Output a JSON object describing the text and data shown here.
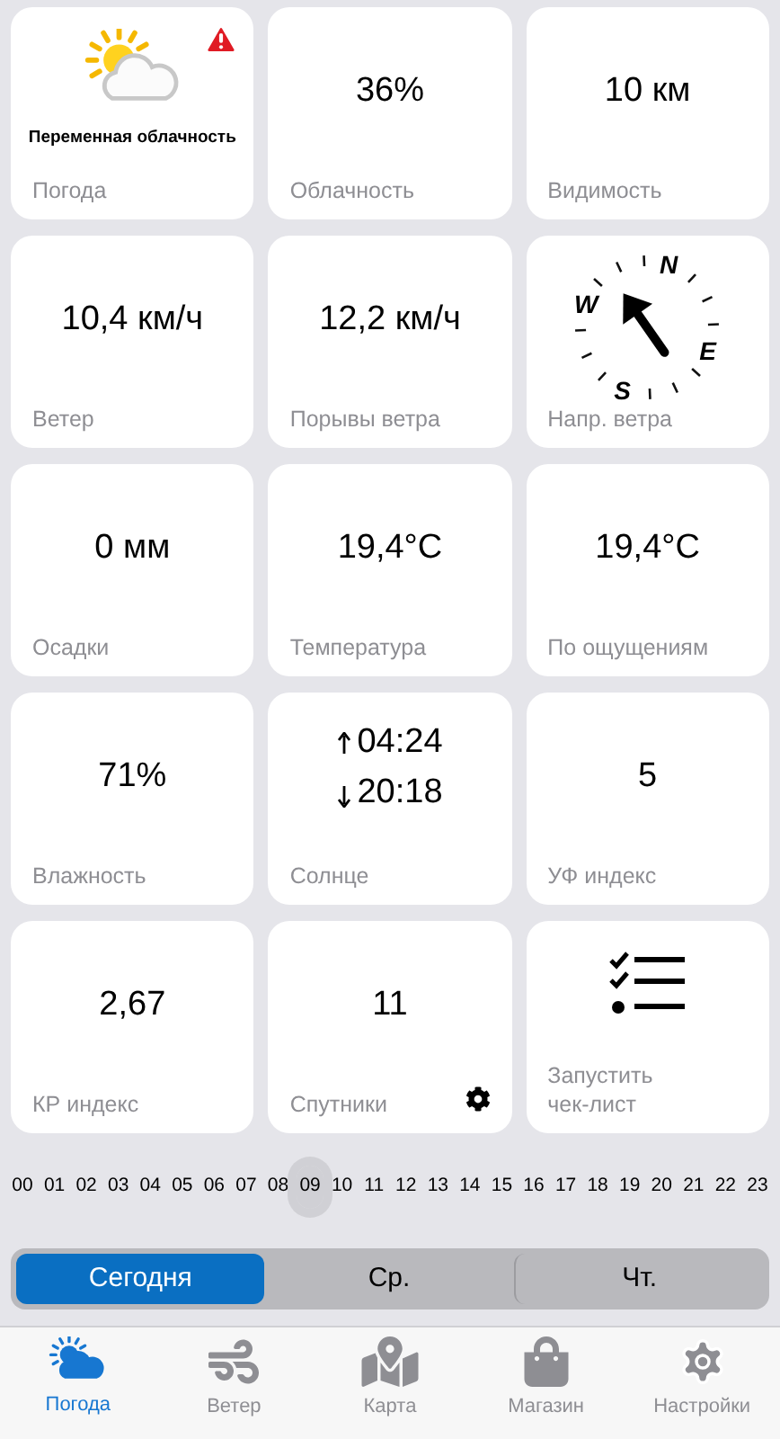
{
  "tiles": [
    {
      "kind": "weather",
      "caption": "Переменная облачность",
      "label": "Погода",
      "alert": true
    },
    {
      "kind": "value",
      "value": "36%",
      "label": "Облачность"
    },
    {
      "kind": "value",
      "value": "10 км",
      "label": "Видимость"
    },
    {
      "kind": "value",
      "value": "10,4 км/ч",
      "label": "Ветер"
    },
    {
      "kind": "value",
      "value": "12,2 км/ч",
      "label": "Порывы ветра"
    },
    {
      "kind": "compass",
      "points": [
        "N",
        "E",
        "S",
        "W"
      ],
      "label": "Напр. ветра"
    },
    {
      "kind": "value",
      "value": "0 мм",
      "label": "Осадки"
    },
    {
      "kind": "value",
      "value": "19,4°C",
      "label": "Температура"
    },
    {
      "kind": "value",
      "value": "19,4°C",
      "label": "По ощущениям"
    },
    {
      "kind": "value",
      "value": "71%",
      "label": "Влажность"
    },
    {
      "kind": "sun",
      "sunrise": "04:24",
      "sunset": "20:18",
      "label": "Солнце"
    },
    {
      "kind": "value",
      "value": "5",
      "label": "УФ индекс"
    },
    {
      "kind": "value",
      "value": "2,67",
      "label": "КР индекс"
    },
    {
      "kind": "value",
      "value": "11",
      "label": "Спутники",
      "settings": true
    },
    {
      "kind": "checklist",
      "label": "Запустить чек-лист"
    }
  ],
  "hours": [
    {
      "label": "00",
      "selected": false
    },
    {
      "label": "01",
      "selected": false
    },
    {
      "label": "02",
      "selected": false
    },
    {
      "label": "03",
      "selected": false
    },
    {
      "label": "04",
      "selected": false
    },
    {
      "label": "05",
      "selected": false
    },
    {
      "label": "06",
      "selected": false
    },
    {
      "label": "07",
      "selected": false
    },
    {
      "label": "08",
      "selected": false
    },
    {
      "label": "09",
      "selected": true
    },
    {
      "label": "10",
      "selected": false
    },
    {
      "label": "11",
      "selected": false
    },
    {
      "label": "12",
      "selected": false
    },
    {
      "label": "13",
      "selected": false
    },
    {
      "label": "14",
      "selected": false
    },
    {
      "label": "15",
      "selected": false
    },
    {
      "label": "16",
      "selected": false
    },
    {
      "label": "17",
      "selected": false
    },
    {
      "label": "18",
      "selected": false
    },
    {
      "label": "19",
      "selected": false
    },
    {
      "label": "20",
      "selected": false
    },
    {
      "label": "21",
      "selected": false
    },
    {
      "label": "22",
      "selected": false
    },
    {
      "label": "23",
      "selected": false
    }
  ],
  "days": [
    {
      "label": "Сегодня",
      "selected": true
    },
    {
      "label": "Ср.",
      "selected": false
    },
    {
      "label": "Чт.",
      "selected": false
    }
  ],
  "nav": [
    {
      "kind": "weather",
      "label": "Погода",
      "selected": true
    },
    {
      "kind": "wind",
      "label": "Ветер",
      "selected": false
    },
    {
      "kind": "map",
      "label": "Карта",
      "selected": false
    },
    {
      "kind": "shop",
      "label": "Магазин",
      "selected": false
    },
    {
      "kind": "settings",
      "label": "Настройки",
      "selected": false
    }
  ]
}
